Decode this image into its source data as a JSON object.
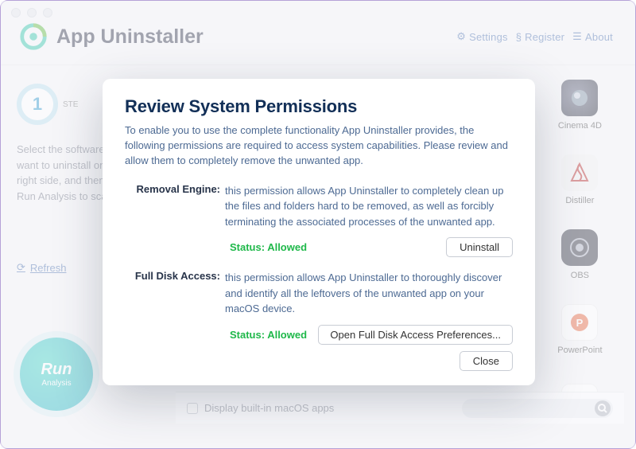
{
  "header": {
    "app_title": "App Uninstaller",
    "links": {
      "settings": "Settings",
      "register": "Register",
      "about": "About"
    }
  },
  "left": {
    "step_number": "1",
    "step_label": "STE",
    "description": "Select the software you want to uninstall on the right side, and then click Run Analysis to scan it.",
    "refresh": "Refresh",
    "run_big": "Run",
    "run_small": "Analysis"
  },
  "apps": {
    "c4d": "Cinema 4D",
    "distiller": "Distiller",
    "obs": "OBS",
    "ppt": "PowerPoint",
    "word": ""
  },
  "bottom": {
    "checkbox_label": "Display built-in macOS apps",
    "search_placeholder": ""
  },
  "modal": {
    "title": "Review System Permissions",
    "description": "To enable you to use the complete functionality App Uninstaller provides, the following permissions are required to access system capabilities. Please review and allow them to completely remove the unwanted app.",
    "perm1": {
      "label": "Removal Engine:",
      "text": "this permission allows App Uninstaller to completely clean up the files and folders hard to be removed, as well as forcibly terminating the associated processes of the unwanted app.",
      "status": "Status: Allowed",
      "button": "Uninstall"
    },
    "perm2": {
      "label": "Full Disk Access:",
      "text": "this permission allows App Uninstaller to thoroughly discover and identify all the leftovers of the unwanted app on your macOS device.",
      "status": "Status: Allowed",
      "button": "Open Full Disk Access Preferences..."
    },
    "close": "Close"
  },
  "colors": {
    "status_green": "#1fb84a",
    "accent_blue": "#3f6da8"
  }
}
